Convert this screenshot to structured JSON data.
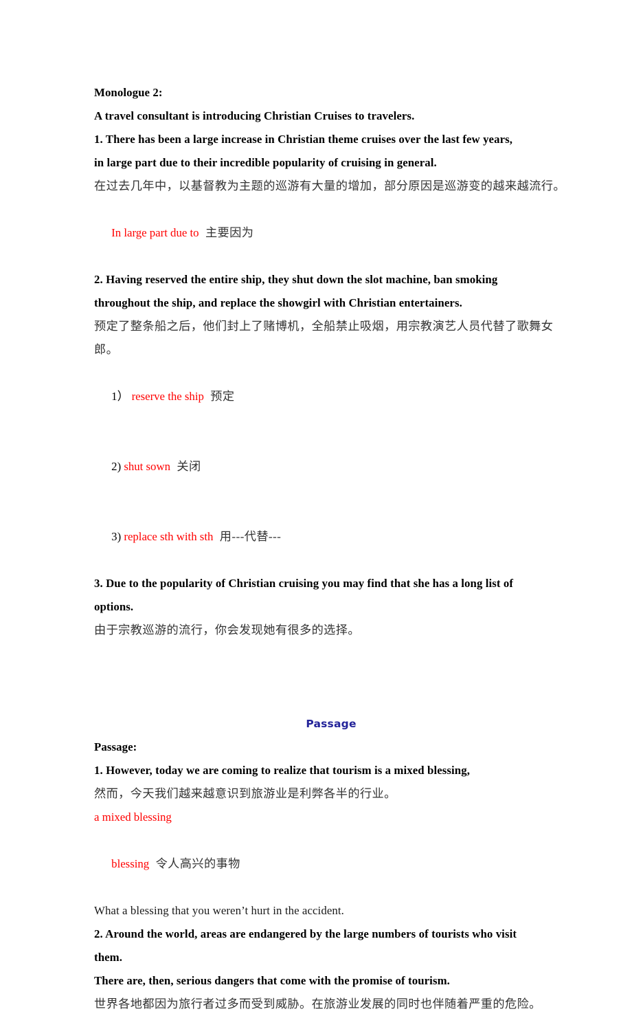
{
  "document": {
    "colors": {
      "body_text": "#1a1a1a",
      "chinese_text": "#333333",
      "note_red": "#ff0000",
      "heading_blue": "#24249a",
      "background": "#ffffff"
    },
    "monologue": {
      "title": "Monologue 2:",
      "subtitle": "A travel consultant is introducing Christian Cruises to travelers.",
      "items": [
        {
          "en_line_1": "1. There has been a large increase in Christian theme cruises over the last few years,",
          "en_line_2": "in large part due to their incredible popularity of cruising in general.",
          "cn": "在过去几年中，以基督教为主题的巡游有大量的增加，部分原因是巡游变的越来越流行。",
          "notes": [
            {
              "marker": "",
              "term": "In large part due to",
              "gloss": "主要因为"
            }
          ]
        },
        {
          "en_line_1": "2. Having reserved the entire ship, they shut down the slot machine, ban smoking",
          "en_line_2": "throughout the ship, and replace the showgirl with Christian entertainers.",
          "cn": "预定了整条船之后，他们封上了赌博机，全船禁止吸烟，用宗教演艺人员代替了歌舞女郎。",
          "notes": [
            {
              "marker": "1）",
              "term": "reserve the ship",
              "gloss": "预定"
            },
            {
              "marker": "2)",
              "term": "shut sown",
              "gloss": "关闭"
            },
            {
              "marker": "3)",
              "term": "replace sth with sth",
              "gloss": "用---代替---"
            }
          ]
        },
        {
          "en_line_1": "3. Due to the popularity of Christian cruising you may find that she has a long list of",
          "en_line_2": "options.",
          "cn": "由于宗教巡游的流行，你会发现她有很多的选择。",
          "notes": []
        }
      ]
    },
    "passage_heading": "Passage",
    "passage": {
      "title": "Passage:",
      "items": [
        {
          "en_line_1": "1. However, today we are coming to realize that tourism is a mixed blessing,",
          "cn": "然而，今天我们越来越意识到旅游业是利弊各半的行业。",
          "note_1_term": "a mixed blessing",
          "note_2_term": "blessing",
          "note_2_gloss": "令人高兴的事物",
          "example": "What a blessing that you weren’t hurt in the accident."
        },
        {
          "en_line_1": "2. Around the world, areas are endangered by the large numbers of tourists who visit",
          "en_line_2": "them.",
          "en_line_3": "There are, then, serious dangers that come with the promise of tourism.",
          "cn": "世界各地都因为旅行者过多而受到威胁。在旅游业发展的同时也伴随着严重的危险。"
        }
      ]
    }
  }
}
